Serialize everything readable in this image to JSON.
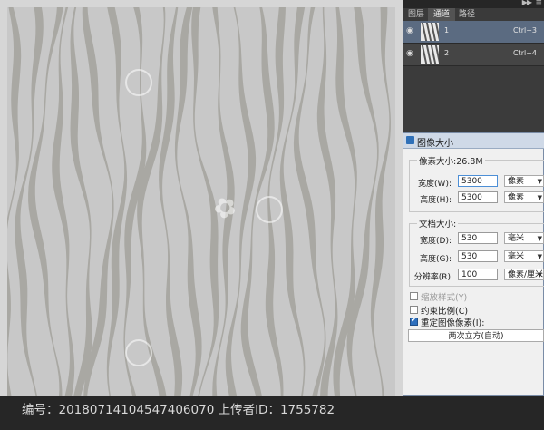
{
  "panel": {
    "tabs": [
      "图层",
      "通道",
      "路径"
    ],
    "active_tab": 1,
    "channels": [
      {
        "name": "1",
        "shortcut": "Ctrl+3",
        "selected": true
      },
      {
        "name": "2",
        "shortcut": "Ctrl+4",
        "selected": false
      }
    ],
    "collapse_icon": "double-chevron-right-icon",
    "menu_icon": "panel-menu-icon"
  },
  "dialog": {
    "title": "图像大小",
    "pixel_dimensions": {
      "label": "像素大小:26.8M",
      "width": {
        "label": "宽度(W):",
        "value": "5300",
        "unit": "像素"
      },
      "height": {
        "label": "高度(H):",
        "value": "5300",
        "unit": "像素"
      }
    },
    "document_size": {
      "label": "文档大小:",
      "width": {
        "label": "宽度(D):",
        "value": "530",
        "unit": "毫米"
      },
      "height": {
        "label": "高度(G):",
        "value": "530",
        "unit": "毫米"
      },
      "resolution": {
        "label": "分辨率(R):",
        "value": "100",
        "unit": "像素/厘米"
      }
    },
    "options": {
      "scale_styles": {
        "label": "缩放样式(Y)",
        "checked": false,
        "enabled": false
      },
      "constrain": {
        "label": "约束比例(C)",
        "checked": false,
        "enabled": true
      },
      "resample": {
        "label": "重定图像像素(I):",
        "checked": true,
        "enabled": true
      }
    },
    "resample_method": "两次立方(自动)"
  },
  "footer": {
    "text": "编号：20180714104547406070 上传者ID：1755782"
  },
  "colors": {
    "pattern_background": "#c8c8c8",
    "pattern_stripes": "#a9a8a3",
    "selection_blue": "#5b6b81"
  }
}
